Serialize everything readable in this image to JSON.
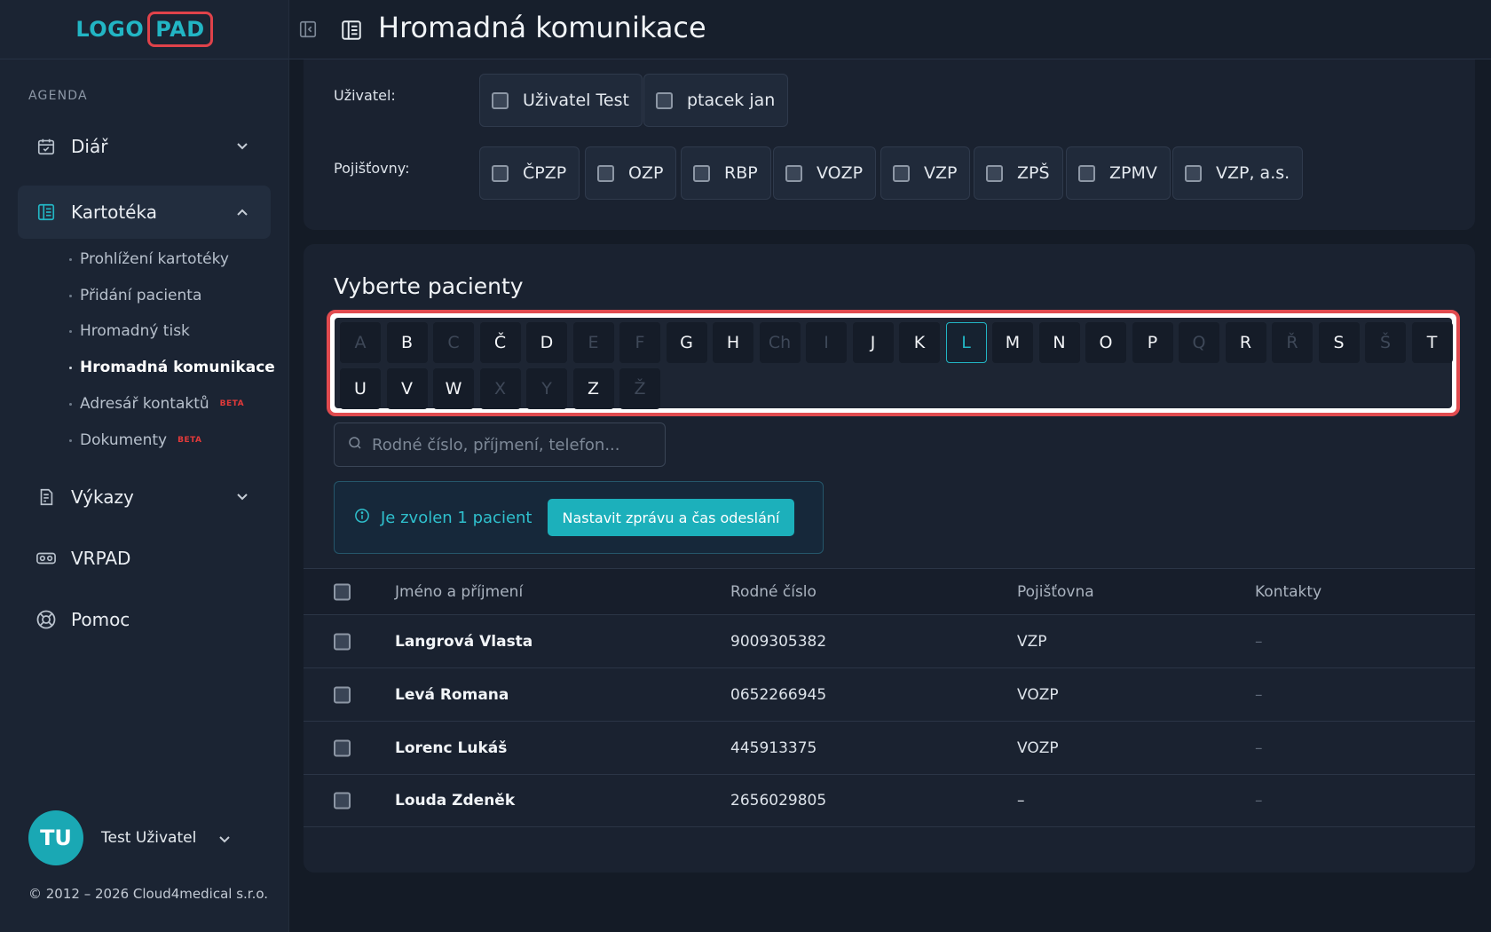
{
  "logo": {
    "part1": "LOGO",
    "part2": "PAD"
  },
  "sidebar": {
    "section": "AGENDA",
    "items": [
      {
        "label": "Diář"
      },
      {
        "label": "Kartotéka"
      },
      {
        "label": "Výkazy"
      },
      {
        "label": "VRPAD"
      },
      {
        "label": "Pomoc"
      }
    ],
    "subitems": [
      {
        "label": "Prohlížení kartotéky"
      },
      {
        "label": "Přidání pacienta"
      },
      {
        "label": "Hromadný tisk"
      },
      {
        "label": "Hromadná komunikace"
      },
      {
        "label": "Adresář kontaktů",
        "badge": "BETA"
      },
      {
        "label": "Dokumenty",
        "badge": "BETA"
      }
    ]
  },
  "user": {
    "initials": "TU",
    "name": "Test Uživatel"
  },
  "copyright": "© 2012 – 2026 Cloud4medical s.r.o.",
  "header": {
    "title": "Hromadná komunikace"
  },
  "filters": {
    "user_label": "Uživatel:",
    "users": [
      "Uživatel Test",
      "ptacek jan"
    ],
    "insurers_label": "Pojišťovny:",
    "insurers": [
      "ČPZP",
      "OZP",
      "RBP",
      "VOZP",
      "VZP",
      "ZPŠ",
      "ZPMV",
      "VZP, a.s."
    ]
  },
  "patients": {
    "title": "Vyberte pacienty",
    "letters": [
      {
        "l": "A",
        "enabled": false
      },
      {
        "l": "B",
        "enabled": true
      },
      {
        "l": "C",
        "enabled": false
      },
      {
        "l": "Č",
        "enabled": true
      },
      {
        "l": "D",
        "enabled": true
      },
      {
        "l": "E",
        "enabled": false
      },
      {
        "l": "F",
        "enabled": false
      },
      {
        "l": "G",
        "enabled": true
      },
      {
        "l": "H",
        "enabled": true
      },
      {
        "l": "Ch",
        "enabled": false
      },
      {
        "l": "I",
        "enabled": false
      },
      {
        "l": "J",
        "enabled": true
      },
      {
        "l": "K",
        "enabled": true
      },
      {
        "l": "L",
        "enabled": true,
        "selected": true
      },
      {
        "l": "M",
        "enabled": true
      },
      {
        "l": "N",
        "enabled": true
      },
      {
        "l": "O",
        "enabled": true
      },
      {
        "l": "P",
        "enabled": true
      },
      {
        "l": "Q",
        "enabled": false
      },
      {
        "l": "R",
        "enabled": true
      },
      {
        "l": "Ř",
        "enabled": false
      },
      {
        "l": "S",
        "enabled": true
      },
      {
        "l": "Š",
        "enabled": false
      },
      {
        "l": "T",
        "enabled": true
      },
      {
        "l": "U",
        "enabled": true
      },
      {
        "l": "V",
        "enabled": true
      },
      {
        "l": "W",
        "enabled": true
      },
      {
        "l": "X",
        "enabled": false
      },
      {
        "l": "Y",
        "enabled": false
      },
      {
        "l": "Z",
        "enabled": true
      },
      {
        "l": "Ž",
        "enabled": false
      }
    ],
    "search_placeholder": "Rodné číslo, příjmení, telefon...",
    "info_text": "Je zvolen 1 pacient",
    "cta_label": "Nastavit zprávu a čas odeslání",
    "columns": [
      "Jméno a příjmení",
      "Rodné číslo",
      "Pojišťovna",
      "Kontakty"
    ],
    "rows": [
      {
        "name": "Langrová Vlasta",
        "rc": "9009305382",
        "insurer": "VZP",
        "contacts": "–"
      },
      {
        "name": "Levá Romana",
        "rc": "0652266945",
        "insurer": "VOZP",
        "contacts": "–"
      },
      {
        "name": "Lorenc Lukáš",
        "rc": "445913375",
        "insurer": "VOZP",
        "contacts": "–"
      },
      {
        "name": "Louda Zdeněk",
        "rc": "2656029805",
        "insurer": "–",
        "contacts": "–"
      }
    ]
  },
  "colors": {
    "accent": "#22b5c4",
    "highlight": "#e14b4f",
    "background": "#141b26"
  }
}
